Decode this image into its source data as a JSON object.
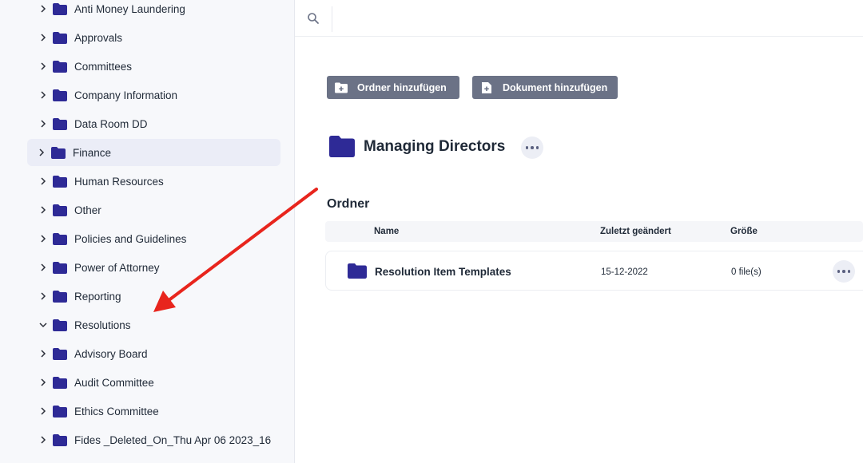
{
  "colors": {
    "folder": "#2e2a96",
    "button_bg": "#6b7286",
    "annotation_arrow": "#e8251d"
  },
  "sidebar": {
    "items": [
      {
        "label": "Anti Money Laundering",
        "expanded": false,
        "selected": false
      },
      {
        "label": "Approvals",
        "expanded": false,
        "selected": false
      },
      {
        "label": "Committees",
        "expanded": false,
        "selected": false
      },
      {
        "label": "Company Information",
        "expanded": false,
        "selected": false
      },
      {
        "label": "Data Room DD",
        "expanded": false,
        "selected": false
      },
      {
        "label": "Finance",
        "expanded": false,
        "selected": true
      },
      {
        "label": "Human Resources",
        "expanded": false,
        "selected": false
      },
      {
        "label": "Other",
        "expanded": false,
        "selected": false
      },
      {
        "label": "Policies and Guidelines",
        "expanded": false,
        "selected": false
      },
      {
        "label": "Power of Attorney",
        "expanded": false,
        "selected": false
      },
      {
        "label": "Reporting",
        "expanded": false,
        "selected": false
      },
      {
        "label": "Resolutions",
        "expanded": true,
        "selected": false
      },
      {
        "label": "Advisory Board",
        "expanded": false,
        "selected": false
      },
      {
        "label": "Audit Committee",
        "expanded": false,
        "selected": false
      },
      {
        "label": "Ethics Committee",
        "expanded": false,
        "selected": false
      },
      {
        "label": "Fides _Deleted_On_Thu Apr 06 2023_16",
        "expanded": false,
        "selected": false
      }
    ]
  },
  "search": {
    "icon": "search-icon"
  },
  "toolbar": {
    "add_folder_label": "Ordner hinzufügen",
    "add_document_label": "Dokument hinzufügen"
  },
  "page": {
    "title": "Managing Directors"
  },
  "folders_section": {
    "title": "Ordner",
    "columns": {
      "name": "Name",
      "modified": "Zuletzt geändert",
      "size": "Größe"
    },
    "rows": [
      {
        "name": "Resolution Item Templates",
        "modified": "15-12-2022",
        "size": "0 file(s)"
      }
    ]
  }
}
